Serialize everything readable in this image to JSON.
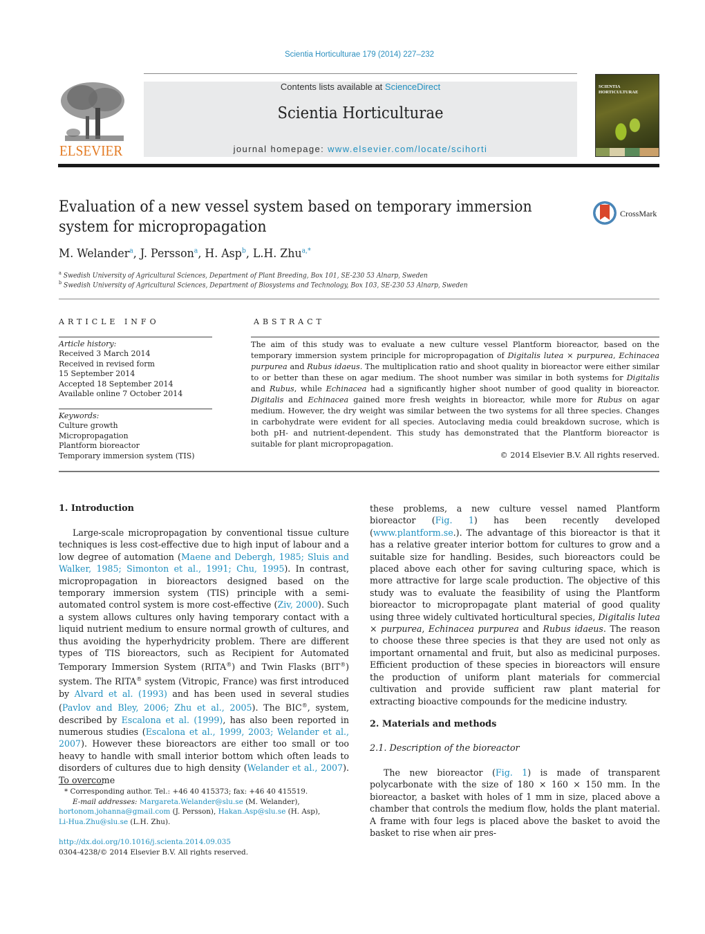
{
  "header": {
    "citation": "Scientia Horticulturae 179 (2014) 227–232",
    "contents_prefix": "Contents lists available at ",
    "contents_link": "ScienceDirect",
    "journal_name": "Scientia Horticulturae",
    "homepage_prefix": "journal homepage: ",
    "homepage_link": "www.elsevier.com/locate/scihorti",
    "publisher_logo_text": "ELSEVIER",
    "cover_title_line1": "SCIENTIA",
    "cover_title_line2": "HORTICULTURAE",
    "crossmark_label": "CrossMark"
  },
  "article": {
    "title_line1": "Evaluation of a new vessel system based on temporary immersion",
    "title_line2": "system for micropropagation",
    "authors": [
      {
        "name": "M. Welander",
        "sup": "a"
      },
      {
        "name": "J. Persson",
        "sup": "a"
      },
      {
        "name": "H. Asp",
        "sup": "b"
      },
      {
        "name": "L.H. Zhu",
        "sup": "a,*"
      }
    ],
    "affiliations": [
      {
        "mark": "a",
        "text": "Swedish University of Agricultural Sciences, Department of Plant Breeding, Box 101, SE-230 53 Alnarp, Sweden"
      },
      {
        "mark": "b",
        "text": "Swedish University of Agricultural Sciences, Department of Biosystems and Technology, Box 103, SE-230 53 Alnarp, Sweden"
      }
    ]
  },
  "article_info": {
    "heading": "ARTICLE INFO",
    "history_label": "Article history:",
    "history": [
      "Received 3 March 2014",
      "Received in revised form",
      "15 September 2014",
      "Accepted 18 September 2014",
      "Available online 7 October 2014"
    ],
    "keywords_label": "Keywords:",
    "keywords": [
      "Culture growth",
      "Micropropagation",
      "Plantform bioreactor",
      "Temporary immersion system (TIS)"
    ]
  },
  "abstract": {
    "heading": "ABSTRACT",
    "segments": [
      {
        "t": "The aim of this study was to evaluate a new culture vessel Plantform bioreactor, based on the temporary immersion system principle for micropropagation of "
      },
      {
        "t": "Digitalis lutea × purpurea",
        "i": true
      },
      {
        "t": ", "
      },
      {
        "t": "Echinacea purpurea",
        "i": true
      },
      {
        "t": " and "
      },
      {
        "t": "Rubus idaeus",
        "i": true
      },
      {
        "t": ". The multiplication ratio and shoot quality in bioreactor were either similar to or better than these on agar medium. The shoot number was similar in both systems for "
      },
      {
        "t": "Digitalis",
        "i": true
      },
      {
        "t": " and "
      },
      {
        "t": "Rubus",
        "i": true
      },
      {
        "t": ", while "
      },
      {
        "t": "Echinacea",
        "i": true
      },
      {
        "t": " had a significantly higher shoot number of good quality in bioreactor. "
      },
      {
        "t": "Digitalis",
        "i": true
      },
      {
        "t": " and "
      },
      {
        "t": "Echinacea",
        "i": true
      },
      {
        "t": " gained more fresh weights in bioreactor, while more for "
      },
      {
        "t": "Rubus",
        "i": true
      },
      {
        "t": " on agar medium. However, the dry weight was similar between the two systems for all three species. Changes in carbohydrate were evident for all species. Autoclaving media could breakdown sucrose, which is both pH- and nutrient-dependent. This study has demonstrated that the Plantform bioreactor is suitable for plant micropropagation."
      }
    ],
    "copyright": "© 2014 Elsevier B.V. All rights reserved."
  },
  "sections": {
    "intro_heading": "1.  Introduction",
    "intro_left": [
      {
        "t": "Large-scale micropropagation by conventional tissue culture techniques is less cost-effective due to high input of labour and a low degree of automation ("
      },
      {
        "t": "Maene and Debergh, 1985; Sluis and Walker, 1985; Simonton et al., 1991; Chu, 1995",
        "l": true
      },
      {
        "t": "). In contrast, micropropagation in bioreactors designed based on the temporary immersion system (TIS) principle with a semi-automated control system is more cost-effective ("
      },
      {
        "t": "Ziv, 2000",
        "l": true
      },
      {
        "t": "). Such a system allows cultures only having temporary contact with a liquid nutrient medium to ensure normal growth of cultures, and thus avoiding the hyperhydricity problem. There are different types of TIS bioreactors, such as Recipient for Automated Temporary Immersion System (RITA"
      },
      {
        "t": "®",
        "s": true
      },
      {
        "t": ") and Twin Flasks (BIT"
      },
      {
        "t": "®",
        "s": true
      },
      {
        "t": ") system. The RITA"
      },
      {
        "t": "®",
        "s": true
      },
      {
        "t": " system (Vitropic, France) was first introduced by "
      },
      {
        "t": "Alvard et al. (1993)",
        "l": true
      },
      {
        "t": " and has been used in several studies ("
      },
      {
        "t": "Pavlov and Bley, 2006; Zhu et al., 2005",
        "l": true
      },
      {
        "t": "). The BIC"
      },
      {
        "t": "®",
        "s": true
      },
      {
        "t": ", system, described by "
      },
      {
        "t": "Escalona et al. (1999)",
        "l": true
      },
      {
        "t": ", has also been reported in numerous studies ("
      },
      {
        "t": "Escalona et al., 1999, 2003; Welander et al., 2007",
        "l": true
      },
      {
        "t": "). However these bioreactors are either too small or too heavy to handle with small interior bottom which often leads to disorders of cultures due to high density ("
      },
      {
        "t": "Welander et al., 2007",
        "l": true
      },
      {
        "t": "). To overcome"
      }
    ],
    "intro_right": [
      {
        "t": "these problems, a new culture vessel named Plantform bioreactor ("
      },
      {
        "t": "Fig. 1",
        "l": true
      },
      {
        "t": ") has been recently developed ("
      },
      {
        "t": "www.plantform.se",
        "l": true
      },
      {
        "t": ".). The advantage of this bioreactor is that it has a relative greater interior bottom for cultures to grow and a suitable size for handling. Besides, such bioreactors could be placed above each other for saving culturing space, which is more attractive for large scale production. The objective of this study was to evaluate the feasibility of using the Plantform bioreactor to micropropagate plant material of good quality using three widely cultivated horticultural species, "
      },
      {
        "t": "Digitalis lutea × purpurea",
        "i": true
      },
      {
        "t": ", "
      },
      {
        "t": "Echinacea purpurea",
        "i": true
      },
      {
        "t": " and "
      },
      {
        "t": "Rubus idaeus",
        "i": true
      },
      {
        "t": ". The reason to choose these three species is that they are used not only as important ornamental and fruit, but also as medicinal purposes. Efficient production of these species in bioreactors will ensure the production of uniform plant materials for commercial cultivation and provide sufficient raw plant material for extracting bioactive compounds for the medicine industry."
      }
    ],
    "methods_heading": "2.  Materials and methods",
    "subsection_heading": "2.1.  Description of the bioreactor",
    "bioreactor_para": [
      {
        "t": "The new bioreactor ("
      },
      {
        "t": "Fig. 1",
        "l": true
      },
      {
        "t": ") is made of transparent polycarbonate with the size of 180 × 160 × 150 mm. In the bioreactor, a basket with holes of 1 mm in size, placed above a chamber that controls the medium flow, holds the plant material. A frame with four legs is placed above the basket to avoid the basket to rise when air pres-"
      }
    ]
  },
  "footnotes": {
    "corresponding": "* Corresponding author. Tel.: +46 40 415373; fax: +46 40 415519.",
    "email_label": "E-mail addresses: ",
    "emails": [
      {
        "email": "Margareta.Welander@slu.se",
        "who": " (M. Welander),"
      },
      {
        "email": "hortonom.johanna@gmail.com",
        "who": " (J. Persson), "
      },
      {
        "email": "Hakan.Asp@slu.se",
        "who": " (H. Asp),"
      },
      {
        "email": "Li-Hua.Zhu@slu.se",
        "who": " (L.H. Zhu)."
      }
    ],
    "doi": "http://dx.doi.org/10.1016/j.scienta.2014.09.035",
    "issn": "0304-4238/© 2014 Elsevier B.V. All rights reserved."
  },
  "colors": {
    "link": "#1f8fbf",
    "elsevier_orange": "#e37a22",
    "banner_gray": "#e9eaeb"
  }
}
